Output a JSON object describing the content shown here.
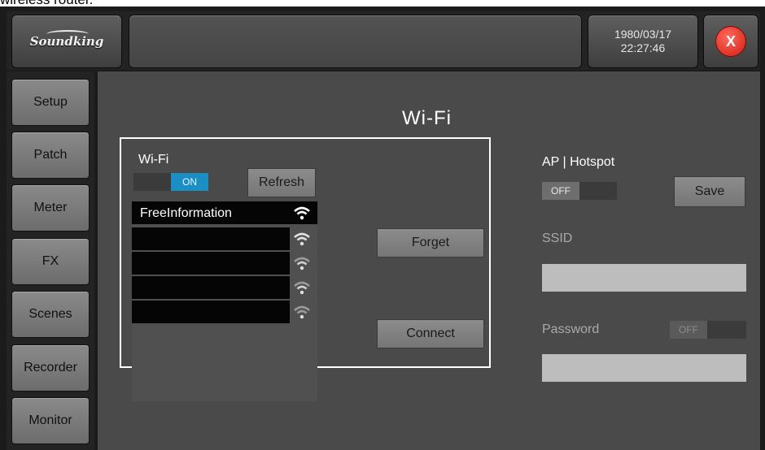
{
  "caption": "wireless router.",
  "header": {
    "logo_text": "Soundking",
    "date": "1980/03/17",
    "time": "22:27:46",
    "close_label": "X"
  },
  "sidebar": {
    "items": [
      {
        "label": "Setup"
      },
      {
        "label": "Patch"
      },
      {
        "label": "Meter"
      },
      {
        "label": "FX"
      },
      {
        "label": "Scenes"
      },
      {
        "label": "Recorder"
      },
      {
        "label": "Monitor"
      }
    ]
  },
  "page": {
    "title": "Wi-Fi"
  },
  "wifi_panel": {
    "label": "Wi-Fi",
    "toggle_state": "ON",
    "refresh_label": "Refresh",
    "networks": [
      {
        "name": "FreeInformation"
      },
      {
        "name": ""
      },
      {
        "name": ""
      },
      {
        "name": ""
      },
      {
        "name": ""
      }
    ],
    "forget_label": "Forget",
    "connect_label": "Connect"
  },
  "hotspot": {
    "label": "AP | Hotspot",
    "toggle_state": "OFF",
    "save_label": "Save",
    "ssid_label": "SSID",
    "ssid_value": "",
    "password_label": "Password",
    "password_toggle_state": "OFF",
    "password_value": ""
  },
  "colors": {
    "toggle_on": "#1b8fc4",
    "background": "#4a4a4a",
    "close_red": "#d01c10"
  }
}
